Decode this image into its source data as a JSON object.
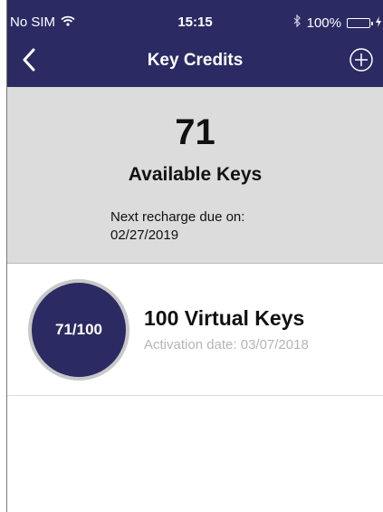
{
  "status_bar": {
    "carrier": "No SIM",
    "time": "15:15",
    "battery_percent": "100%",
    "battery_level": 1.0,
    "icons": [
      "wifi-icon",
      "bluetooth-icon",
      "battery-icon",
      "charging-icon"
    ]
  },
  "nav": {
    "title": "Key Credits",
    "back_icon": "chevron-left-icon",
    "add_icon": "plus-circle-icon"
  },
  "summary": {
    "count": "71",
    "label": "Available Keys",
    "recharge_label": "Next recharge due on:",
    "recharge_date": "02/27/2019"
  },
  "keys": [
    {
      "badge": "71/100",
      "title": "100 Virtual Keys",
      "activation": "Activation date: 03/07/2018"
    }
  ],
  "colors": {
    "brand": "#2b2a63",
    "summary_bg": "#dcdcdc",
    "battery": "#4cd964",
    "muted_text": "#b5b5b5"
  }
}
